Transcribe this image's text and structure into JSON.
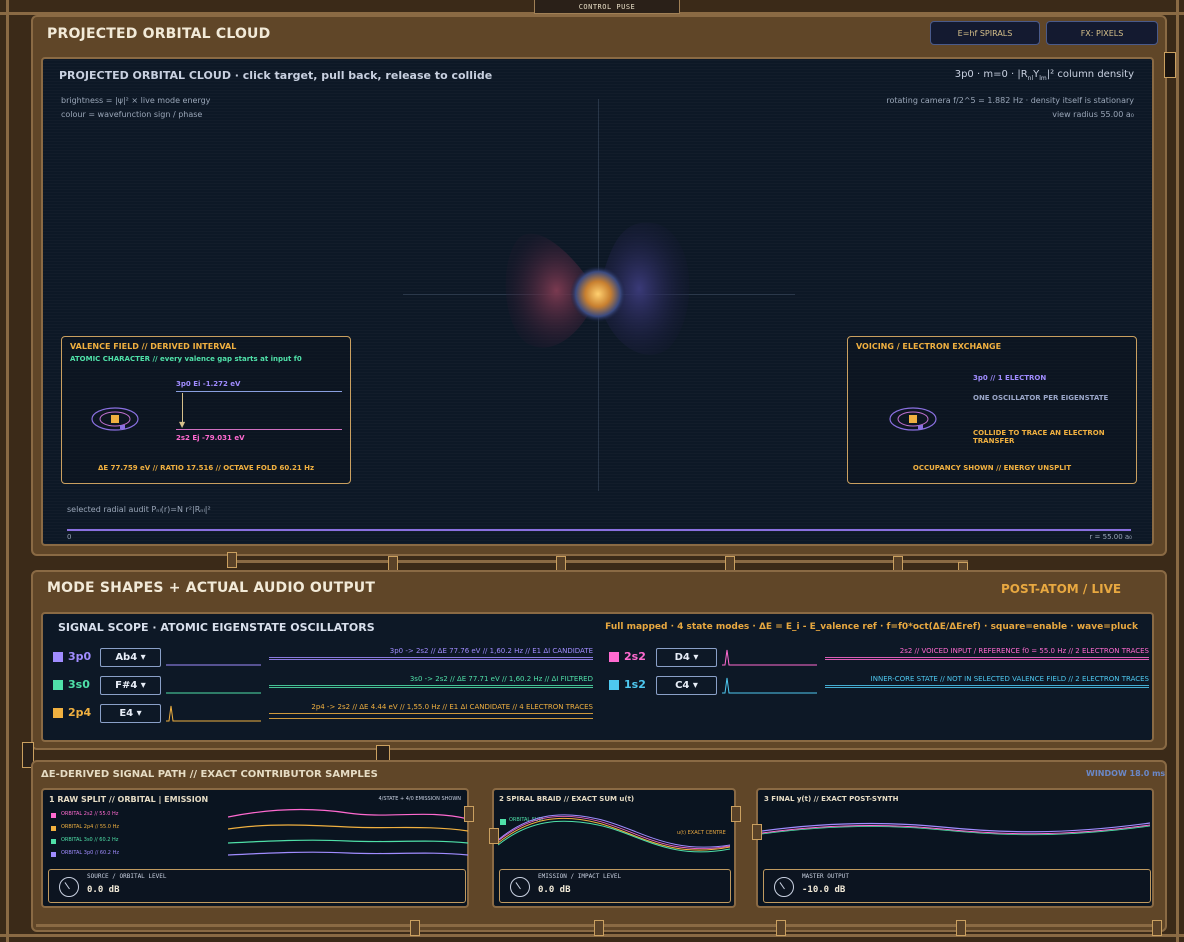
{
  "top_tab": {
    "label": "CONTROL PUSE"
  },
  "orbital": {
    "title": "PROJECTED ORBITAL CLOUD",
    "buttons": {
      "spirals": "E=hf SPIRALS",
      "pixels": "FX: PIXELS"
    },
    "header": "PROJECTED ORBITAL CLOUD · click target, pull back, release to collide",
    "density": "3p0 · m=0 · |R",
    "density_sub": "nl",
    "density_y": "Y",
    "density_y_sub": "lm",
    "density_end": "|² column density",
    "brightness": "brightness = |ψ|² × live mode energy",
    "colour": "colour = wavefunction sign / phase",
    "camera": "rotating camera f/2^5 = 1.882 Hz · density itself is stationary",
    "view_radius": "view radius 55.00 a₀",
    "radial_audit": "selected radial audit  Pₙₗ(r)=N r²|Rₙₗ|²",
    "axis_min": "0",
    "axis_max": "r = 55.00 a₀",
    "valence": {
      "title": "VALENCE FIELD // DERIVED INTERVAL",
      "subtitle": "ATOMIC CHARACTER // every valence gap starts at input f0",
      "upper": "3p0  Ei -1.272 eV",
      "lower": "2s2  Ej -79.031 eV",
      "summary": "ΔE 77.759 eV // RATIO 17.516 // OCTAVE FOLD 60.21 Hz"
    },
    "voicing": {
      "title": "VOICING / ELECTRON EXCHANGE",
      "line1": "3p0 // 1 ELECTRON",
      "line2": "ONE OSCILLATOR PER EIGENSTATE",
      "line3": "COLLIDE TO TRACE AN ELECTRON TRANSFER",
      "line4": "OCCUPANCY SHOWN // ENERGY UNSPLIT"
    }
  },
  "modes": {
    "title": "MODE SHAPES + ACTUAL AUDIO OUTPUT",
    "status": "POST-ATOM / LIVE",
    "scope_title": "SIGNAL SCOPE · ATOMIC EIGENSTATE OSCILLATORS",
    "scope_info": "Full mapped · 4 state modes · ΔE = E_i - E_valence ref · f=f0*oct(ΔE/ΔEref) · square=enable · wave=pluck",
    "rows": [
      {
        "name": "3p0",
        "note": "Ab4 ▾",
        "color": "#a08cff",
        "label_color": "#a08cff",
        "ann": "3p0 -> 2s2 // ΔE 77.76 eV // 1,60.2 Hz // E1 ΔI CANDIDATE"
      },
      {
        "name": "3s0",
        "note": "F#4 ▾",
        "color": "#4fe0a8",
        "label_color": "#4fe0a8",
        "ann": "3s0 -> 2s2 // ΔE 77.71 eV // 1,60.2 Hz // ΔI FILTERED"
      },
      {
        "name": "2p4",
        "note": "E4 ▾",
        "color": "#f0b040",
        "label_color": "#f0b040",
        "ann": "2p4 -> 2s2 // ΔE 4.44 eV // 1,55.0 Hz // E1 ΔI CANDIDATE // 4 ELECTRON TRACES"
      },
      {
        "name": "2s2",
        "note": "D4 ▾",
        "color": "#ff6ad0",
        "label_color": "#ff6ad0",
        "ann": "2s2 // VOICED INPUT / REFERENCE f0 = 55.0 Hz // 2 ELECTRON TRACES"
      },
      {
        "name": "1s2",
        "note": "C4 ▾",
        "color": "#4ec8f0",
        "label_color": "#4ec8f0",
        "ann": "INNER-CORE STATE // NOT IN SELECTED VALENCE FIELD // 2 ELECTRON TRACES"
      }
    ]
  },
  "path": {
    "title": "ΔE-DERIVED SIGNAL PATH // EXACT CONTRIBUTOR SAMPLES",
    "window": "WINDOW 18.0 ms",
    "raw": {
      "title": "1 RAW SPLIT // ORBITAL  |  EMISSION",
      "note": "4/STATE + 4/0 EMISSION SHOWN",
      "legend": [
        {
          "label": "ORBITAL 2s2 // 55.0 Hz",
          "color": "#ff6ad0"
        },
        {
          "label": "ORBITAL 2p4 // 55.0 Hz",
          "color": "#f0b040"
        },
        {
          "label": "ORBITAL 3s0 // 60.2 Hz",
          "color": "#4fe0a8"
        },
        {
          "label": "ORBITAL 3p0 // 60.2 Hz",
          "color": "#a08cff"
        }
      ],
      "knob_label": "SOURCE / ORBITAL LEVEL",
      "knob_value": "0.0 dB"
    },
    "spiral": {
      "title": "2 SPIRAL BRAID // EXACT SUM u(t)",
      "legend": "ORBITAL SUM",
      "centre": "u(t) EXACT CENTRE",
      "knob_label": "EMISSION / IMPACT LEVEL",
      "knob_value": "0.0 dB"
    },
    "final": {
      "title": "3 FINAL y(t) // EXACT POST-SYNTH",
      "knob_label": "MASTER OUTPUT",
      "knob_value": "-10.0 dB"
    }
  }
}
